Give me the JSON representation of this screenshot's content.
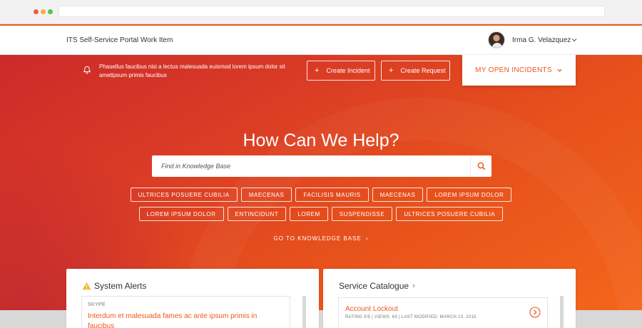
{
  "colors": {
    "accent": "#f0571c",
    "hero_start": "#cc2a2a",
    "hero_end": "#f4661b"
  },
  "header": {
    "title": "ITS Self-Service Portal Work Item",
    "user_name": "Irma G. Velazquez"
  },
  "hero": {
    "notice": "Phasellus faucibus nisi a lectus malesuada euismod lorem ipsum dolor sit ametipsum primis faucibus",
    "create_incident_label": "Create Incident",
    "create_request_label": "Create Request",
    "open_incidents_label": "MY OPEN INCIDENTS",
    "headline": "How Can We Help?",
    "search_placeholder": "Find in Knowledge Base",
    "tags_row1": [
      "ULTRICES POSUERE CUBILIA",
      "MAECENAS",
      "FACILISIS MAURIS",
      "MAECENAS",
      "LOREM IPSUM DOLOR"
    ],
    "tags_row2": [
      "LOREM IPSUM DOLOR",
      "ENTINCIDUNT",
      "LOREM",
      "SUSPENDISSE",
      "ULTRICES POSUERE CUBILIA"
    ],
    "kb_link_label": "GO TO KNOWLEDGE BASE"
  },
  "alerts": {
    "title": "System Alerts",
    "source": "SKYPE",
    "text": "Interdum et malesuada fames ac ante ipsum primis in faucibus"
  },
  "catalogue": {
    "title": "Service Catalogue",
    "item_title": "Account Lockout",
    "item_meta": "RATING 0/5 | VIEWS: 63 | LAST MODIFIED: MARCH 10, 2015"
  }
}
